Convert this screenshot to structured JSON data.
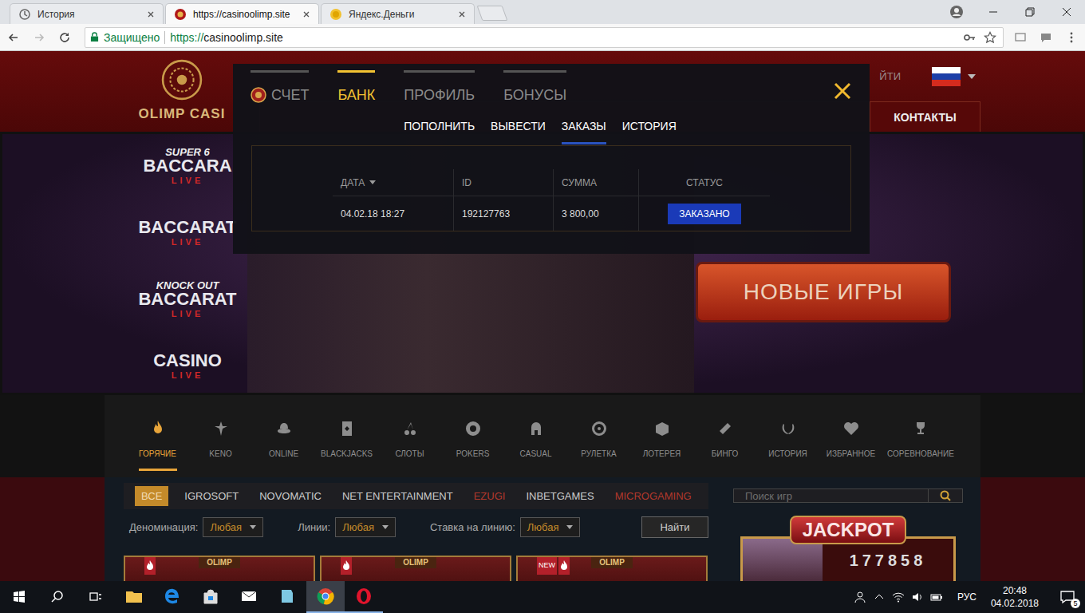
{
  "browser": {
    "tabs": [
      {
        "label": "История",
        "selected": false
      },
      {
        "label": "https://casinoolimp.site",
        "selected": true
      },
      {
        "label": "Яндекс.Деньги",
        "selected": false
      }
    ],
    "address": {
      "security": "Защищено",
      "scheme": "https://",
      "host": "casinoolimp.site"
    }
  },
  "site": {
    "logo": "OLIMP CASI",
    "login": "ЙТИ",
    "nav": [
      "КОНТАКТЫ"
    ],
    "banner": {
      "logos": [
        {
          "top": "SUPER 6",
          "name": "BACCARA",
          "sub": "LIVE"
        },
        {
          "name": "BACCARAT",
          "sub": "LIVE"
        },
        {
          "top": "KNOCK OUT",
          "name": "BACCARAT",
          "sub": "LIVE"
        },
        {
          "name": "CASINO",
          "sub": "LIVE"
        }
      ],
      "button": "НОВЫЕ ИГРЫ"
    },
    "categories": [
      {
        "label": "ГОРЯЧИЕ",
        "selected": true
      },
      {
        "label": "KENO",
        "selected": false
      },
      {
        "label": "ONLINE",
        "selected": false
      },
      {
        "label": "BLACKJACKS",
        "selected": false
      },
      {
        "label": "СЛОТЫ",
        "selected": false
      },
      {
        "label": "POKERS",
        "selected": false
      },
      {
        "label": "CASUAL",
        "selected": false
      },
      {
        "label": "РУЛЕТКА",
        "selected": false
      },
      {
        "label": "ЛОТЕРЕЯ",
        "selected": false
      },
      {
        "label": "БИНГО",
        "selected": false
      },
      {
        "label": "ИСТОРИЯ",
        "selected": false
      },
      {
        "label": "ИЗБРАННОЕ",
        "selected": false
      },
      {
        "label": "СОРЕВНОВАНИЕ",
        "selected": false
      }
    ],
    "providers": [
      {
        "label": "ВСЕ",
        "selected": true,
        "color": "#f3dcb4"
      },
      {
        "label": "IGROSOFT",
        "selected": false,
        "color": "#cccccc"
      },
      {
        "label": "NOVOMATIC",
        "selected": false,
        "color": "#cccccc"
      },
      {
        "label": "NET ENTERTAINMENT",
        "selected": false,
        "color": "#cccccc"
      },
      {
        "label": "EZUGI",
        "selected": false,
        "color": "#b2382c"
      },
      {
        "label": "INBETGAMES",
        "selected": false,
        "color": "#cccccc"
      },
      {
        "label": "MICROGAMING",
        "selected": false,
        "color": "#b2382c"
      }
    ],
    "filters": [
      {
        "label": "Деноминация:",
        "value": "Любая"
      },
      {
        "label": "Линии:",
        "value": "Любая"
      },
      {
        "label": "Ставка на линию:",
        "value": "Любая"
      }
    ],
    "find_button": "Найти",
    "search": {
      "placeholder": "Поиск игр"
    },
    "jackpot": {
      "title": "JACKPOT",
      "amount": "177858"
    },
    "games": [
      {
        "label": "OLIMP",
        "tags": []
      },
      {
        "label": "OLIMP",
        "tags": []
      },
      {
        "label": "OLIMP",
        "tags": [
          "NEW"
        ]
      }
    ]
  },
  "modal": {
    "tabs": [
      {
        "label": "СЧЕТ",
        "selected": false
      },
      {
        "label": "БАНК",
        "selected": true
      },
      {
        "label": "ПРОФИЛЬ",
        "selected": false
      },
      {
        "label": "БОНУСЫ",
        "selected": false
      }
    ],
    "subtabs": [
      {
        "label": "ПОПОЛНИТЬ",
        "selected": false
      },
      {
        "label": "ВЫВЕСТИ",
        "selected": false
      },
      {
        "label": "ЗАКАЗЫ",
        "selected": true
      },
      {
        "label": "ИСТОРИЯ",
        "selected": false
      }
    ],
    "table": {
      "columns": [
        {
          "label": "ДАТА",
          "sorted": true
        },
        {
          "label": "ID",
          "sorted": false
        },
        {
          "label": "СУММА",
          "sorted": false
        },
        {
          "label": "СТАТУС",
          "sorted": false
        }
      ],
      "rows": [
        {
          "date": "04.02.18 18:27",
          "id": "192127763",
          "amount": "3 800,00",
          "status": "ЗАКАЗАНО"
        }
      ]
    }
  },
  "taskbar": {
    "apps": [
      {
        "running": false,
        "selected": false
      },
      {
        "running": false,
        "selected": false
      },
      {
        "running": false,
        "selected": false
      },
      {
        "running": false,
        "selected": false
      },
      {
        "running": false,
        "selected": false
      },
      {
        "running": true,
        "selected": true
      },
      {
        "running": true,
        "selected": false
      }
    ],
    "language": "РУС",
    "time": "20:48",
    "date": "04.02.2018",
    "notifications": "5"
  }
}
